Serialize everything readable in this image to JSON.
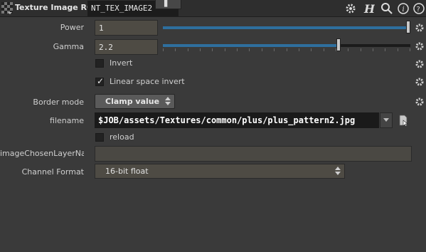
{
  "header": {
    "node_type": "Texture Image RGB",
    "node_name": "NT_TEX_IMAGE2",
    "icons": [
      "texture-node-icon",
      "gear-icon",
      "houdini-h-icon",
      "search-icon",
      "info-icon",
      "help-icon"
    ]
  },
  "parms": {
    "power": {
      "label": "Power",
      "value": "1",
      "slider_level": 1.0
    },
    "gamma": {
      "label": "Gamma",
      "value": "2.2",
      "slider_level": 0.71
    },
    "invert": {
      "label": "Invert",
      "checked": false
    },
    "linear_invert": {
      "label": "Linear space invert",
      "checked": true
    },
    "border_mode": {
      "label": "Border mode",
      "value": "Clamp value"
    },
    "filename": {
      "label": "filename",
      "value": "$JOB/assets/Textures/common/plus/plus_pattern2.jpg"
    },
    "reload": {
      "label": "reload",
      "checked": false
    },
    "image_layer": {
      "label": "imageChosenLayerNa...",
      "value": ""
    },
    "channel_format": {
      "label": "Channel Format",
      "value": "16-bit float"
    }
  },
  "colors": {
    "background": "#3a3a3a",
    "field": "#4e4b44",
    "slider_fill": "#2e6f9e"
  }
}
